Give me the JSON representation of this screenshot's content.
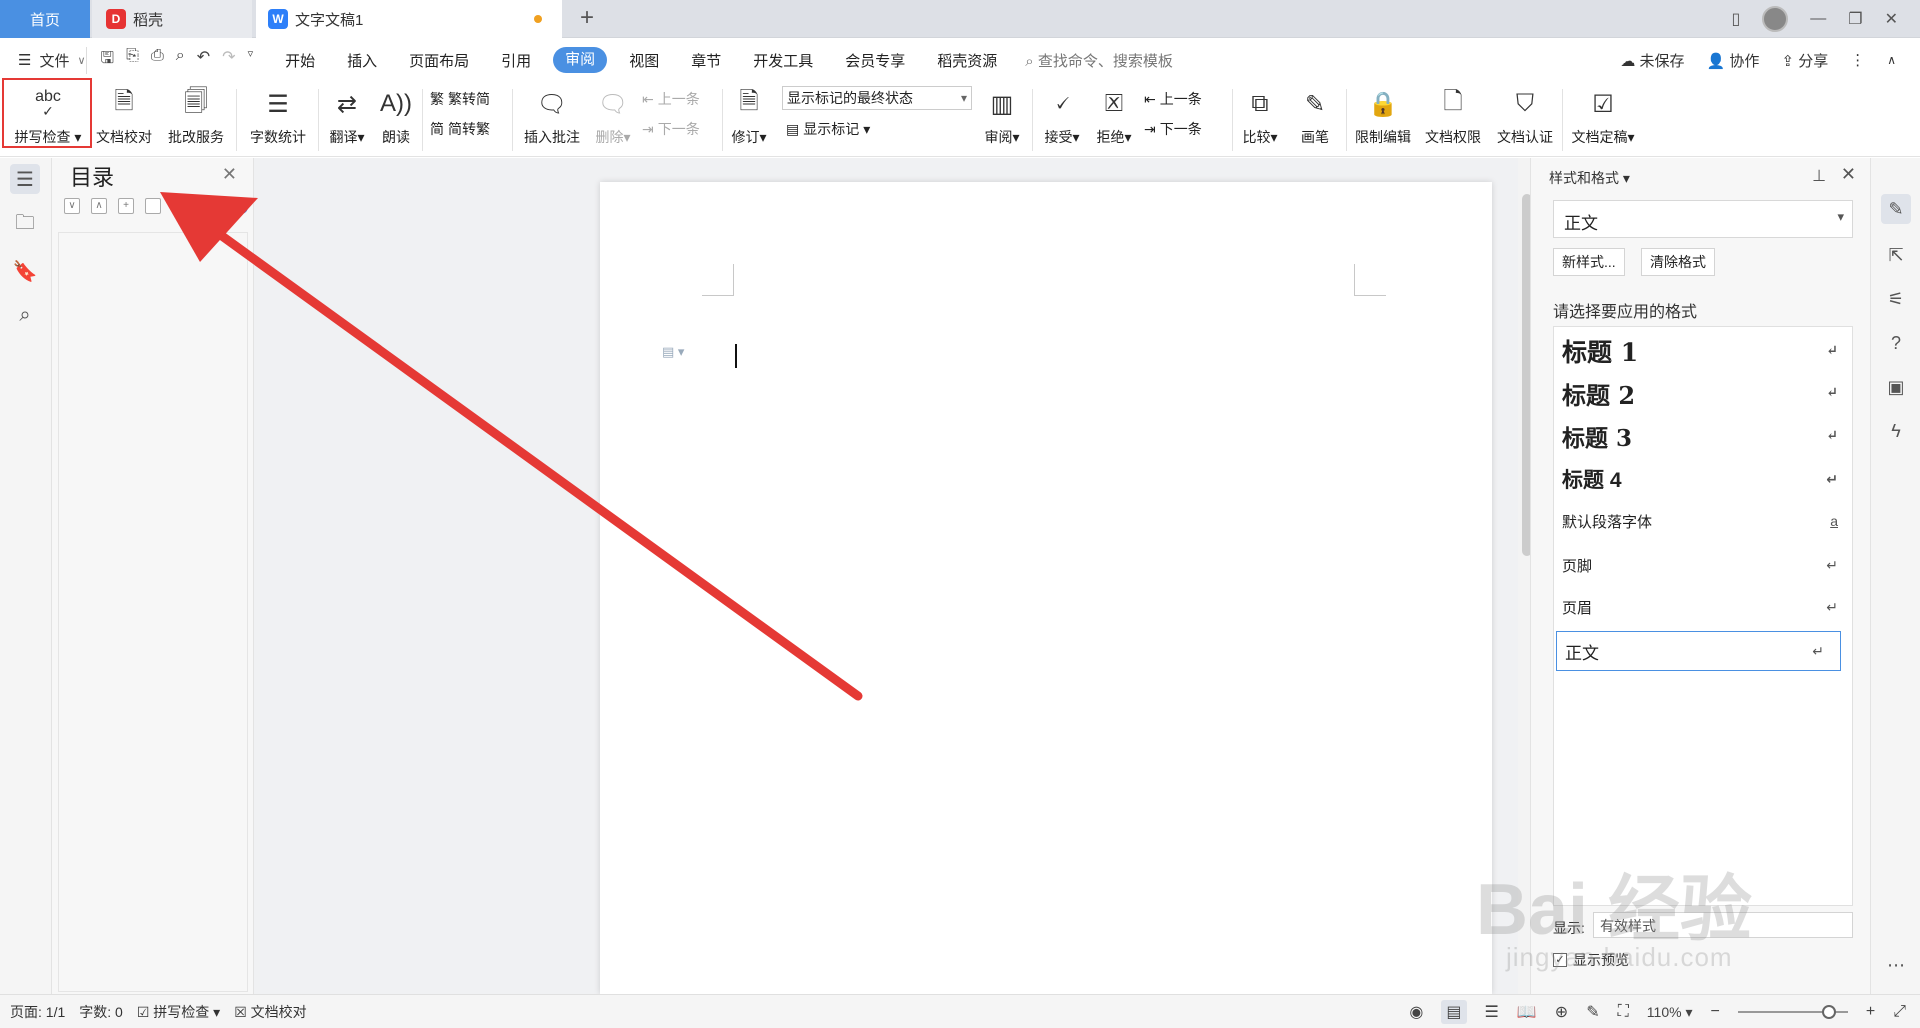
{
  "tabs": {
    "home": "首页",
    "daoke": "稻壳",
    "doc": "文字文稿1"
  },
  "menu": {
    "file": "文件",
    "tabs": [
      "开始",
      "插入",
      "页面布局",
      "引用",
      "审阅",
      "视图",
      "章节",
      "开发工具",
      "会员专享",
      "稻壳资源"
    ],
    "active_tab": "审阅",
    "search_placeholder": "查找命令、搜索模板",
    "unsaved": "未保存",
    "collab": "协作",
    "share": "分享"
  },
  "ribbon": {
    "spellcheck": "拼写检查",
    "doc_proof": "文档校对",
    "revise_service": "批改服务",
    "word_count": "字数统计",
    "translate": "翻译",
    "read_aloud": "朗读",
    "trad_to_simp": "繁转简",
    "simp_to_trad": "简转繁",
    "insert_comment": "插入批注",
    "delete": "删除",
    "prev": "上一条",
    "next": "下一条",
    "markup_state": "显示标记的最终状态",
    "revise": "修订",
    "show_markup": "显示标记",
    "review": "审阅",
    "accept": "接受",
    "reject": "拒绝",
    "prev2": "上一条",
    "next2": "下一条",
    "compare": "比较",
    "pen": "画笔",
    "restrict_edit": "限制编辑",
    "doc_permission": "文档权限",
    "doc_auth": "文档认证",
    "doc_final": "文档定稿"
  },
  "nav": {
    "title": "目录"
  },
  "styles_panel": {
    "title": "样式和格式",
    "current_style": "正文",
    "new_style": "新样式...",
    "clear_format": "清除格式",
    "choose_label": "请选择要应用的格式",
    "items": [
      {
        "label": "标题  1",
        "mark": "↵"
      },
      {
        "label": "标题  2",
        "mark": "↵"
      },
      {
        "label": "标题  3",
        "mark": "↵"
      },
      {
        "label": "标题  4",
        "mark": "↵"
      },
      {
        "label": "默认段落字体",
        "mark": "a"
      },
      {
        "label": "页脚",
        "mark": "↵"
      },
      {
        "label": "页眉",
        "mark": "↵"
      },
      {
        "label": "正文",
        "mark": "↵"
      }
    ],
    "show_label": "显示:",
    "show_value": "有效样式",
    "preview_label": "显示预览"
  },
  "status": {
    "page": "页面: 1/1",
    "word_count": "字数: 0",
    "spellcheck": "拼写检查",
    "doc_proof": "文档校对",
    "zoom": "110%"
  },
  "watermark": {
    "brand": "Bai 经验",
    "url": "jingyan.baidu.com"
  },
  "colors": {
    "accent": "#4a90e2",
    "arrow": "#e53935",
    "highlight": "#e53935"
  }
}
